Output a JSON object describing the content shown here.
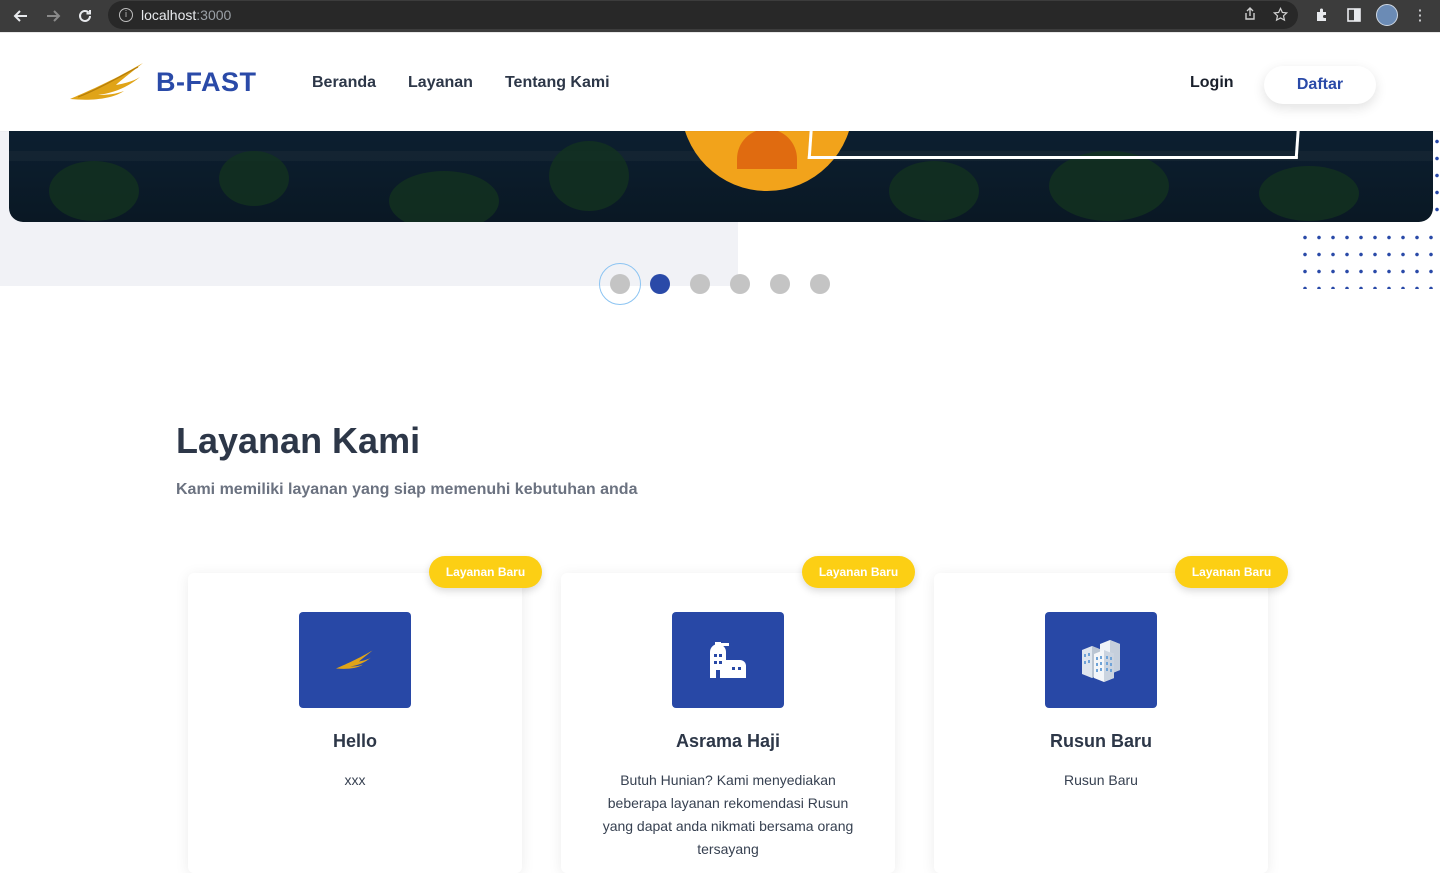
{
  "browser": {
    "url_host": "localhost",
    "url_port": ":3000"
  },
  "header": {
    "logo_text": "B-FAST",
    "nav": [
      "Beranda",
      "Layanan",
      "Tentang Kami"
    ],
    "login_label": "Login",
    "register_label": "Daftar"
  },
  "carousel": {
    "slide_count": 6,
    "active_index": 1
  },
  "services": {
    "title": "Layanan Kami",
    "subtitle": "Kami memiliki layanan yang siap memenuhi kebutuhan anda",
    "cards": [
      {
        "badge": "Layanan Baru",
        "icon": "bird-logo-icon",
        "title": "Hello",
        "desc": "xxx"
      },
      {
        "badge": "Layanan Baru",
        "icon": "building-icon",
        "title": "Asrama Haji",
        "desc": "Butuh Hunian? Kami menyediakan beberapa layanan rekomendasi Rusun yang dapat anda nikmati bersama orang tersayang"
      },
      {
        "badge": "Layanan Baru",
        "icon": "apartment-blocks-icon",
        "title": "Rusun Baru",
        "desc": "Rusun Baru"
      }
    ]
  },
  "colors": {
    "brand": "#2a4aa8",
    "badge": "#fccf14",
    "accent_gold": "#e0a418"
  }
}
